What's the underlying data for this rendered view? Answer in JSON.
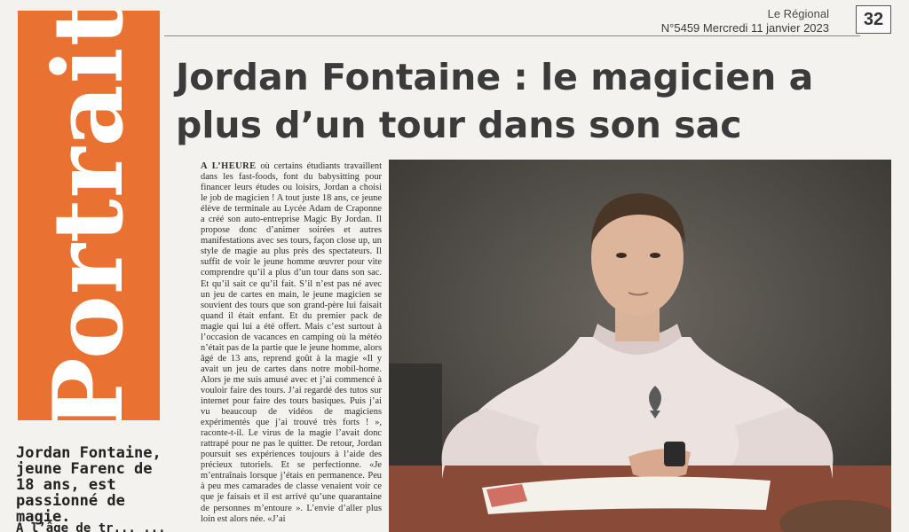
{
  "header": {
    "paper_name": "Le Régional",
    "issue_line": "N°5459 Mercredi 11 janvier 2023",
    "page_number": "32"
  },
  "section_label": "Portrait",
  "headline": "Jordan Fontaine : le magicien a plus d’un tour dans son sac",
  "caption": "Jordan Fontaine, jeune Farenc de 18 ans, est passionné de magie.",
  "caption_continuation": "À l’âge de tr... ...",
  "article": {
    "lead": "A L’HEURE",
    "body": " où certains étudiants travaillent dans les fast-foods, font du babysitting pour financer leurs études ou loisirs, Jordan a choisi le job de magicien ! A tout juste 18 ans, ce jeune élève de terminale au Lycée Adam de Craponne a créé son auto-entreprise Magic By Jordan. Il propose donc d’animer soirées et autres manifestations avec ses tours, façon close up, un style de magie au plus près des spectateurs. Il suffit de voir le jeune homme œuvrer pour vite comprendre qu’il a plus d’un tour dans son sac. Et qu’il sait ce qu’il fait. S’il n’est pas né avec un jeu de cartes en main, le jeune magicien se souvient des tours que son grand-père lui faisait quand il était enfant. Et du premier pack de magie qui lui a été offert. Mais c’est surtout à l’occasion de vacances en camping où la météo n’était pas de la partie que le jeune homme, alors âgé de 13 ans, reprend goût à la magie «Il y avait un jeu de cartes dans notre mobil-home. Alors je me suis amusé avec et j’ai commencé à vouloir faire des tours. J’ai regardé des tutos sur internet pour faire des tours basiques. Puis j’ai vu beaucoup de vidéos de magiciens expérimentés que j’ai trouvé très forts ! », raconte-t-il. Le virus de la magie l’avait donc rattrapé pour ne pas le quitter. De retour, Jordan poursuit ses expériences toujours à l’aide des précieux tutoriels. Et se perfectionne. «Je m’entraînais lorsque j’étais en permanence. Peu à peu mes camarades de classe venaient voir ce que je faisais et il est arrivé qu’une quarantaine de personnes m’entoure ». L’envie d’aller plus loin est alors née. «J’ai"
  },
  "photo": {
    "icon": "spade-icon"
  },
  "colors": {
    "section_band": "#e97131",
    "headline": "#3b3b3b",
    "paper": "#f3f2ee"
  }
}
